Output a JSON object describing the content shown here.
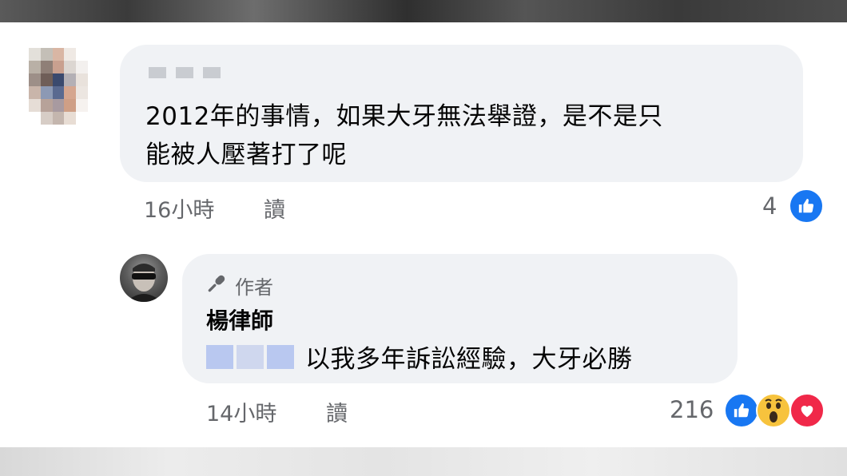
{
  "comment1": {
    "author_redacted": "",
    "text_line1": "2012年的事情，如果大牙無法舉證，是不是只",
    "text_line2": "能被人壓著打了呢",
    "time": "16小時",
    "read_label": "讀",
    "reaction_count": "4",
    "reactions": [
      "like-icon"
    ]
  },
  "reply1": {
    "author_badge": "作者",
    "author_name": "楊律師",
    "mention_redacted": "",
    "text": "以我多年訴訟經驗，大牙必勝",
    "time": "14小時",
    "read_label": "讀",
    "reaction_count": "216",
    "reactions": [
      "like-icon",
      "wow-icon",
      "heart-icon"
    ]
  },
  "colors": {
    "bubble": "#f0f2f5",
    "meta_text": "#65676b",
    "like_blue": "#1877f2",
    "heart_red": "#f02849",
    "wow_yellow": "#f7c33d"
  }
}
